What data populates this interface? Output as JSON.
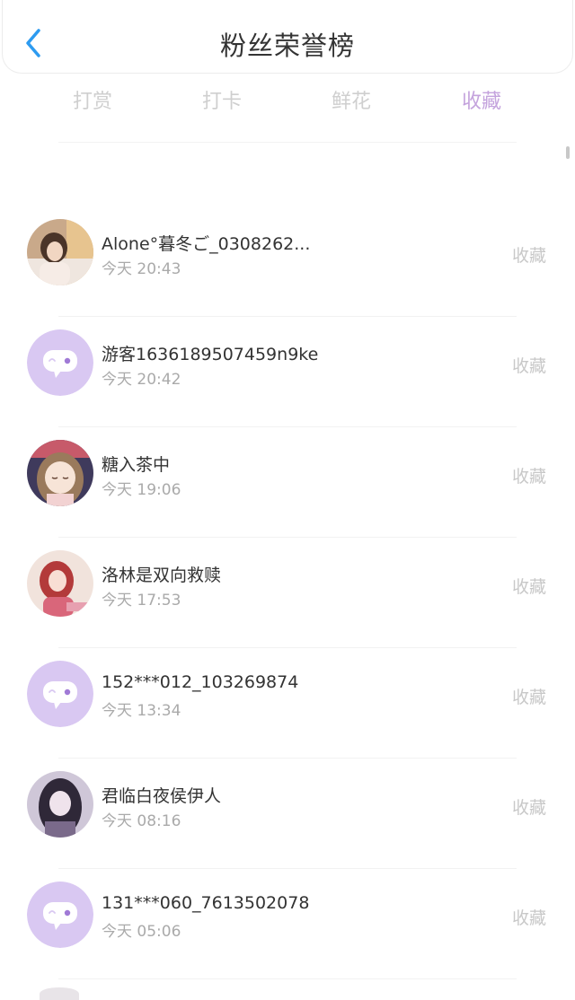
{
  "header": {
    "title": "粉丝荣誉榜",
    "back_icon": "chevron-left-icon"
  },
  "tabs": [
    {
      "label": "打赏",
      "active": false
    },
    {
      "label": "打卡",
      "active": false
    },
    {
      "label": "鲜花",
      "active": false
    },
    {
      "label": "收藏",
      "active": true
    }
  ],
  "colors": {
    "accent": "#c4a3dd",
    "back": "#2d9bf0",
    "placeholder_avatar": "#d9c8f2"
  },
  "items": [
    {
      "name": "Alone°暮冬ご_0308262...",
      "time": "今天 20:43",
      "action": "收藏",
      "avatar": "photo"
    },
    {
      "name": "游客1636189507459n9ke",
      "time": "今天 20:42",
      "action": "收藏",
      "avatar": "default"
    },
    {
      "name": "糖入茶中",
      "time": "今天 19:06",
      "action": "收藏",
      "avatar": "anime-girl"
    },
    {
      "name": "洛林是双向救赎",
      "time": "今天 17:53",
      "action": "收藏",
      "avatar": "anime-red"
    },
    {
      "name": "152***012_103269874",
      "time": "今天 13:34",
      "action": "收藏",
      "avatar": "default"
    },
    {
      "name": "君临白夜侯伊人",
      "time": "今天 08:16",
      "action": "收藏",
      "avatar": "anime-dark"
    },
    {
      "name": "131***060_7613502078",
      "time": "今天 05:06",
      "action": "收藏",
      "avatar": "default"
    }
  ]
}
